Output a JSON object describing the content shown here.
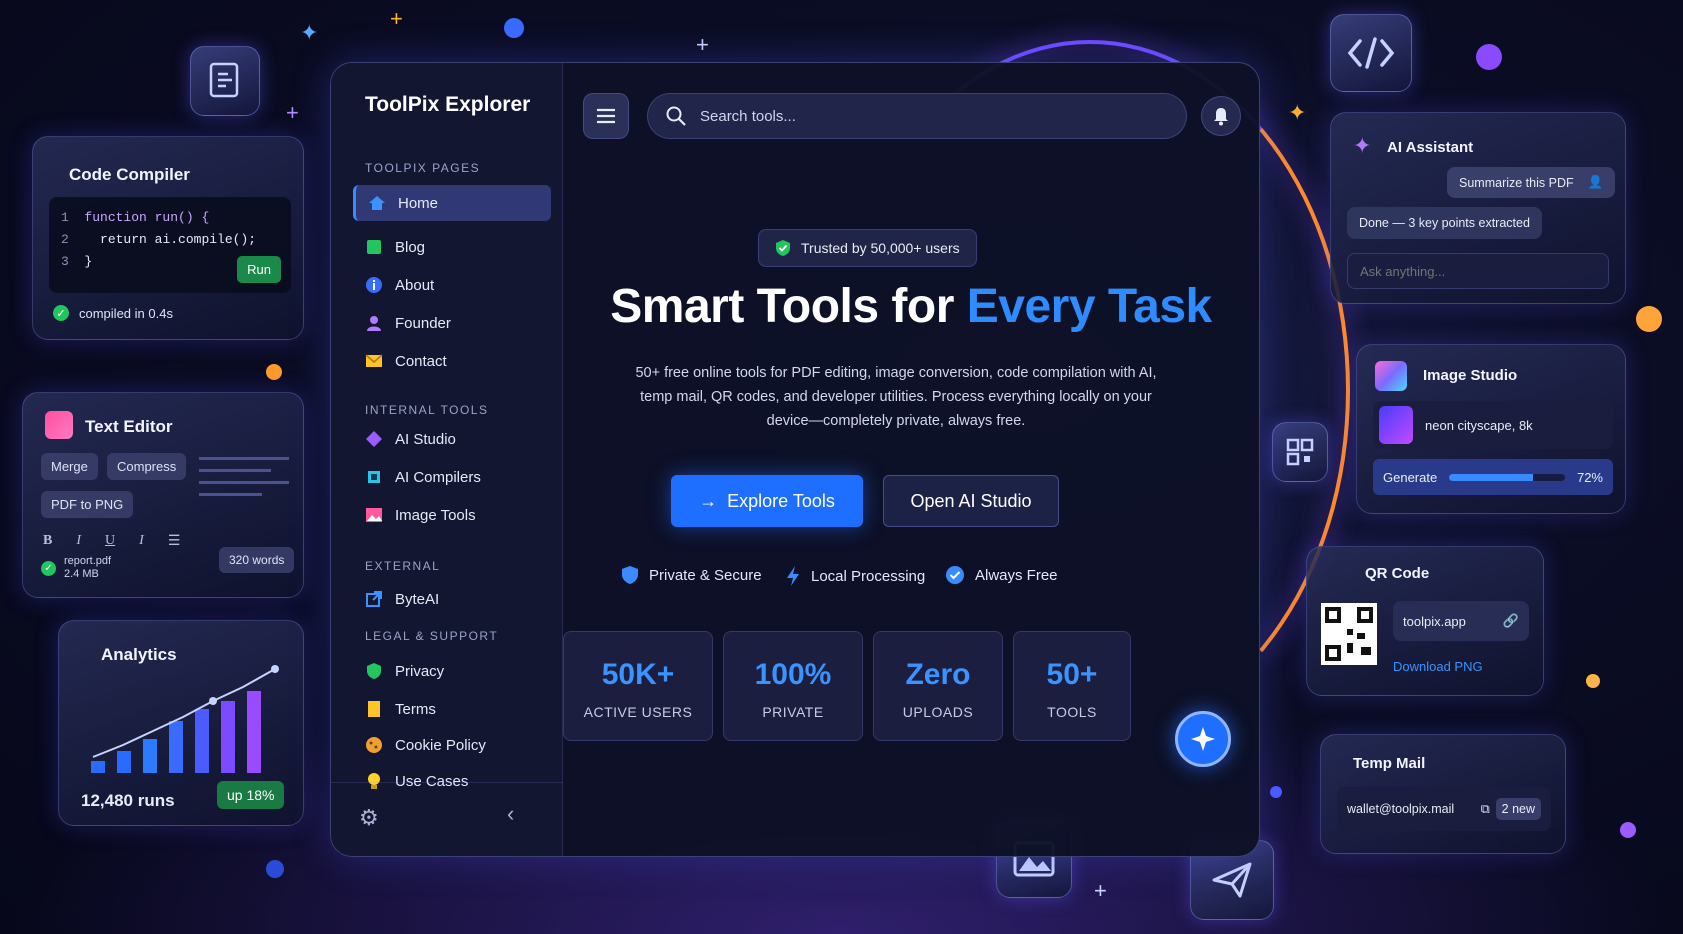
{
  "app": {
    "title": "ToolPix Explorer"
  },
  "search": {
    "placeholder": "Search tools..."
  },
  "sidebar": {
    "sections": [
      {
        "label": "TOOLPIX PAGES"
      },
      {
        "label": "INTERNAL TOOLS"
      },
      {
        "label": "EXTERNAL"
      },
      {
        "label": "LEGAL & SUPPORT"
      }
    ],
    "items": [
      {
        "label": "Home",
        "icon": "home-icon"
      },
      {
        "label": "Blog",
        "icon": "blog-icon"
      },
      {
        "label": "About",
        "icon": "info-icon"
      },
      {
        "label": "Founder",
        "icon": "user-icon"
      },
      {
        "label": "Contact",
        "icon": "mail-icon"
      },
      {
        "label": "AI Studio",
        "icon": "ai-studio-icon"
      },
      {
        "label": "AI Compilers",
        "icon": "chip-icon"
      },
      {
        "label": "Image Tools",
        "icon": "image-icon"
      },
      {
        "label": "ByteAI",
        "icon": "external-link-icon"
      },
      {
        "label": "Privacy",
        "icon": "shield-icon"
      },
      {
        "label": "Terms",
        "icon": "document-icon"
      },
      {
        "label": "Cookie Policy",
        "icon": "cookie-icon"
      },
      {
        "label": "Use Cases",
        "icon": "lightbulb-icon"
      }
    ]
  },
  "hero": {
    "badge": "Trusted by 50,000+ users",
    "title_main": "Smart Tools for ",
    "title_accent": "Every Task",
    "description": "50+ free online tools for PDF editing, image conversion, code compilation with AI, temp mail, QR codes, and developer utilities. Process everything locally on your device—completely private, always free.",
    "primary_cta": "Explore Tools",
    "secondary_cta": "Open AI Studio",
    "features": [
      "Private & Secure",
      "Local Processing",
      "Always Free"
    ],
    "stats": [
      {
        "value": "50K+",
        "label": "ACTIVE USERS"
      },
      {
        "value": "100%",
        "label": "PRIVATE"
      },
      {
        "value": "Zero",
        "label": "UPLOADS"
      },
      {
        "value": "50+",
        "label": "TOOLS"
      }
    ]
  },
  "code_compiler": {
    "title": "Code Compiler",
    "line_numbers": [
      "1",
      "2",
      "3"
    ],
    "lines": [
      "function run() {",
      "return ai.compile();",
      "}"
    ],
    "run_label": "Run",
    "status": "compiled in 0.4s"
  },
  "text_editor": {
    "title": "Text Editor",
    "chips": [
      "Merge",
      "Compress",
      "PDF to PNG"
    ],
    "format_buttons": [
      "B",
      "I",
      "U",
      "I"
    ],
    "file_name": "report.pdf",
    "file_size": "2.4 MB",
    "word_count": "320 words"
  },
  "analytics": {
    "title": "Analytics",
    "runs": "12,480 runs",
    "change": "up 18%"
  },
  "ai_assistant": {
    "title": "AI Assistant",
    "user_msg": "Summarize this PDF",
    "reply": "Done — 3 key points extracted",
    "placeholder": "Ask anything..."
  },
  "image_studio": {
    "title": "Image Studio",
    "prompt": "neon cityscape, 8k",
    "action": "Generate",
    "progress_pct": "72%",
    "progress_value": 0.72
  },
  "qr_code": {
    "title": "QR Code",
    "url": "toolpix.app",
    "download": "Download PNG"
  },
  "temp_mail": {
    "title": "Temp Mail",
    "address": "wallet@toolpix.mail",
    "count": "2 new"
  },
  "colors": {
    "accent": "#2f8cff",
    "bg": "#0b0d24",
    "success": "#22c55e"
  }
}
